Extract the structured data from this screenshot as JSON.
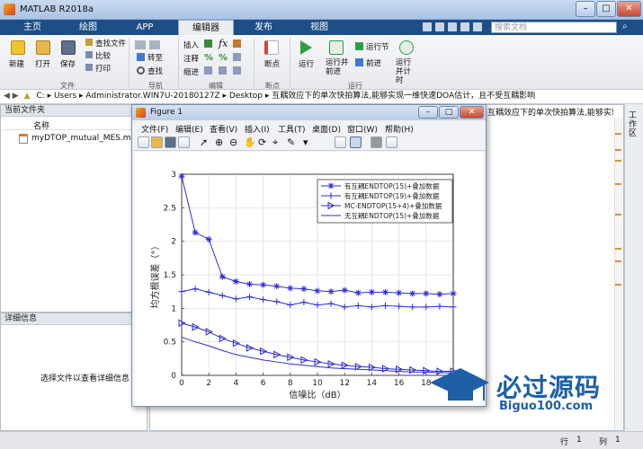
{
  "window": {
    "title": "MATLAB R2018a",
    "btn_min": "–",
    "btn_max": "□",
    "btn_close": "✕"
  },
  "tabs": [
    {
      "label": "主页"
    },
    {
      "label": "绘图"
    },
    {
      "label": "APP"
    },
    {
      "label": "编辑器"
    },
    {
      "label": "发布"
    },
    {
      "label": "视图"
    }
  ],
  "search": {
    "placeholder": "搜索文档"
  },
  "ribbon": {
    "file": {
      "new": "新建",
      "open": "打开",
      "save": "保存",
      "find_files": "查找文件",
      "compare": "比较",
      "print": "打印",
      "group": "文件"
    },
    "nav": {
      "goto": "转至",
      "find": "查找",
      "group": "导航"
    },
    "edit": {
      "insert": "插入",
      "comment": "注释",
      "indent": "缩进",
      "group": "编辑"
    },
    "breakpoints": {
      "label": "断点",
      "group": "断点"
    },
    "run": {
      "run": "运行",
      "run_advance": "运行并前进",
      "run_section": "运行节",
      "advance": "前进",
      "run_time": "运行并计时",
      "group": "运行"
    }
  },
  "address": {
    "parts": [
      "C:",
      "Users",
      "Administrator.WIN7U-20180127Z",
      "Desktop",
      "互耦效应下的单次快拍算法,能够实现一维快速DOA估计，且不受互耦影响"
    ]
  },
  "current_folder": {
    "title": "当前文件夹",
    "col_name": "名称",
    "files": [
      "myDTOP_mutual_MES.m"
    ]
  },
  "details": {
    "title": "详细信息",
    "message": "选择文件以查看详细信息"
  },
  "editor_tab": {
    "label": "互耦效应下的单次快拍算法,能够实现一维快速DOA估计，..."
  },
  "workspace_label": "工作区",
  "figure": {
    "title": "Figure 1",
    "menu": [
      "文件(F)",
      "编辑(E)",
      "查看(V)",
      "插入(I)",
      "工具(T)",
      "桌面(D)",
      "窗口(W)",
      "帮助(H)"
    ]
  },
  "status": {
    "row_label": "行",
    "row": "1",
    "col_label": "列",
    "col": "1"
  },
  "watermark": {
    "line1": "必过源码",
    "line2": "Biguo100.com"
  },
  "chart_data": {
    "type": "line",
    "xlabel": "信噪比（dB）",
    "ylabel": "均方根误差（°）",
    "xlim": [
      0,
      20
    ],
    "ylim": [
      0,
      3
    ],
    "xticks": [
      0,
      2,
      4,
      6,
      8,
      10,
      12,
      14,
      16,
      18
    ],
    "yticks": [
      0,
      0.5,
      1,
      1.5,
      2,
      2.5,
      3
    ],
    "grid": true,
    "legend_position": "top-right",
    "x": [
      0,
      1,
      2,
      3,
      4,
      5,
      6,
      7,
      8,
      9,
      10,
      11,
      12,
      13,
      14,
      15,
      16,
      17,
      18,
      19,
      20
    ],
    "series": [
      {
        "name": "有互耦ENDTOP(15)+叠加数据",
        "marker": "star",
        "color": "#2b2bd6",
        "values": [
          2.97,
          2.13,
          2.03,
          1.47,
          1.4,
          1.36,
          1.35,
          1.33,
          1.3,
          1.29,
          1.26,
          1.25,
          1.27,
          1.23,
          1.24,
          1.24,
          1.23,
          1.22,
          1.22,
          1.21,
          1.22
        ]
      },
      {
        "name": "有互耦ENDTOP(19)+叠加数据",
        "marker": "plus",
        "color": "#2b2bd6",
        "values": [
          1.25,
          1.29,
          1.24,
          1.19,
          1.14,
          1.17,
          1.13,
          1.1,
          1.05,
          1.09,
          1.05,
          1.07,
          1.02,
          1.04,
          1.02,
          1.04,
          1.03,
          1.02,
          1.02,
          1.03,
          1.02
        ]
      },
      {
        "name": "MC-ENDTOP(15+4)+叠加数据",
        "marker": "triangle-right",
        "color": "#2b2bd6",
        "values": [
          0.78,
          0.72,
          0.65,
          0.55,
          0.48,
          0.41,
          0.36,
          0.31,
          0.27,
          0.23,
          0.2,
          0.17,
          0.15,
          0.13,
          0.12,
          0.1,
          0.09,
          0.08,
          0.07,
          0.06,
          0.06
        ]
      },
      {
        "name": "无互耦ENDTOP(15)+叠加数据",
        "marker": "none",
        "color": "#2b2bd6",
        "values": [
          0.57,
          0.5,
          0.44,
          0.37,
          0.31,
          0.27,
          0.23,
          0.2,
          0.17,
          0.15,
          0.13,
          0.11,
          0.1,
          0.09,
          0.08,
          0.07,
          0.06,
          0.05,
          0.05,
          0.04,
          0.04
        ]
      }
    ]
  }
}
